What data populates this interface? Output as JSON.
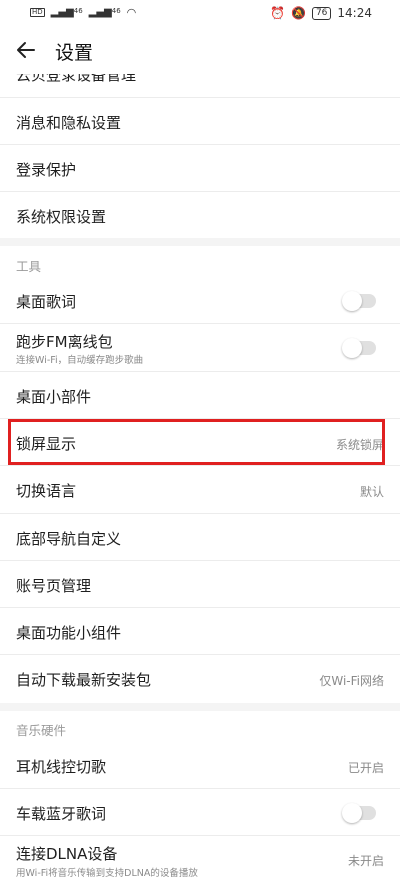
{
  "status_bar": {
    "left_tags": [
      "HD",
      "HD"
    ],
    "signal_label": "46",
    "signal2_label": "46",
    "battery": "76",
    "time": "14:24"
  },
  "header": {
    "title": "设置",
    "back_icon": "arrow-left-icon"
  },
  "top_section": {
    "partial_item": "云贝登录设备管理",
    "items": [
      "消息和隐私设置",
      "登录保护",
      "系统权限设置"
    ]
  },
  "tools_section": {
    "header": "工具",
    "items": {
      "desktop_lyrics": "桌面歌词",
      "running_fm": "跑步FM离线包",
      "running_fm_sub": "连接Wi-Fi，自动缓存跑步歌曲",
      "desktop_widget": "桌面小部件",
      "lock_screen": "锁屏显示",
      "lock_screen_value": "系统锁屏",
      "language": "切换语言",
      "language_value": "默认",
      "bottom_nav": "底部导航自定义",
      "account_page": "账号页管理",
      "desktop_func_widget": "桌面功能小组件",
      "auto_download": "自动下载最新安装包",
      "auto_download_value": "仅Wi-Fi网络"
    }
  },
  "hardware_section": {
    "header": "音乐硬件",
    "items": {
      "earphone": "耳机线控切歌",
      "earphone_value": "已开启",
      "car_bt_lyrics": "车载蓝牙歌词",
      "dlna": "连接DLNA设备",
      "dlna_sub": "用Wi-Fi将音乐传输到支持DLNA的设备播放",
      "dlna_value": "未开启"
    }
  },
  "toggles": {
    "desktop_lyrics": false,
    "running_fm": false,
    "car_bt_lyrics": false
  },
  "colors": {
    "highlight": "#e02020",
    "toggle_off": "#e0e0e0"
  }
}
